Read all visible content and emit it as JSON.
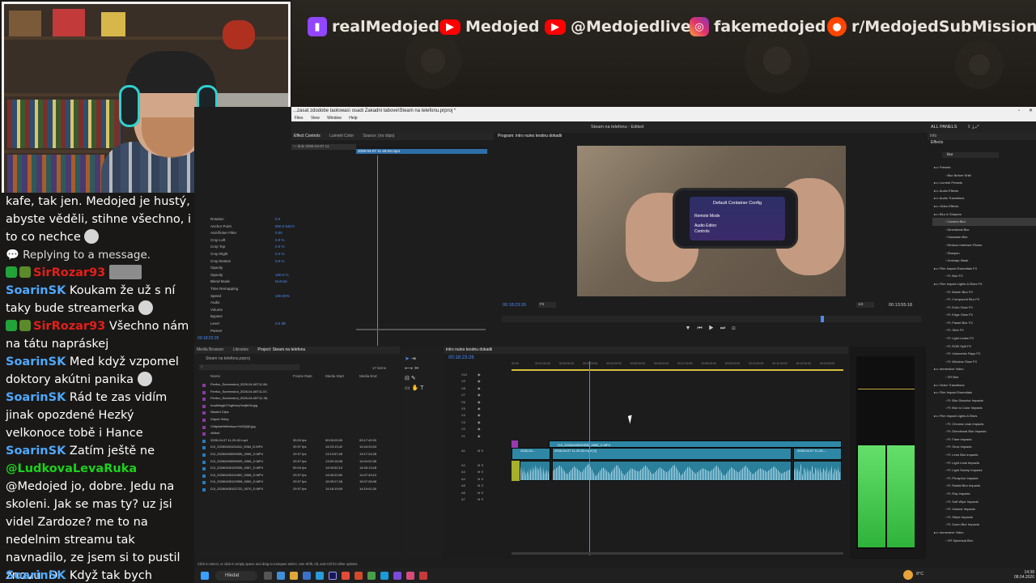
{
  "banner": {
    "socials": [
      {
        "icon": "twitch-icon",
        "label": "realMedojed"
      },
      {
        "icon": "youtube-icon",
        "label": "Medojed"
      },
      {
        "icon": "youtube-icon",
        "label": "@Medojedlive"
      },
      {
        "icon": "instagram-icon",
        "label": "fakemedojed"
      },
      {
        "icon": "reddit-icon",
        "label": "r/MedojedSubMissions"
      }
    ]
  },
  "chat": {
    "messages": [
      {
        "type": "text",
        "text": "kafe, tak jen. Medojed je hustý, abyste věděli, stihne všechno, i to co nechce"
      },
      {
        "type": "reply_notice",
        "text": "Replying to a message."
      },
      {
        "type": "msg",
        "user": "SirRozar93",
        "user_color": "#e0201b",
        "text": ""
      },
      {
        "type": "msg",
        "user": "SoarinSK",
        "user_color": "#4ea8ff",
        "text": "Koukam že už s ní taky bude streamerka"
      },
      {
        "type": "msg",
        "user": "SirRozar93",
        "user_color": "#e0201b",
        "text": "Všechno nám na tátu napráskej"
      },
      {
        "type": "msg",
        "user": "SoarinSK",
        "user_color": "#4ea8ff",
        "text": "Med když vzpomel doktory akútni panika"
      },
      {
        "type": "msg",
        "user": "SoarinSK",
        "user_color": "#4ea8ff",
        "text": "Rád te zas vidím jinak opozdené Hezký velkonoce tobě i Hance"
      },
      {
        "type": "msg",
        "user": "SoarinSK",
        "user_color": "#4ea8ff",
        "text": "Zatím ještě ne"
      },
      {
        "type": "mention",
        "mention": "@LudkovaLevaRuka",
        "text": "@Medojed jo, dobre. Jedu na skoleni. Jak se mas ty? uz jsi videl Zardoze? me to na nedelnim streamu tak navnadilo, ze jsem si to pustil znovu :D"
      },
      {
        "type": "msg",
        "user": "SoarinSK",
        "user_color": "#4ea8ff",
        "text": "Když tak bych napsal"
      }
    ]
  },
  "premiere": {
    "title_bar": "...zasat zdodobe taolowas\\ osadi Zakadni tabove\\Steam na telefonu.prproj *",
    "menu": [
      "Files",
      "View",
      "Window",
      "Help"
    ],
    "workspace_title": "Steam na telefonu - Edited",
    "workspace_right": "ALL PANELS",
    "effect_controls": {
      "tabs": [
        "Effect Controls",
        "Lumetri Color",
        "Source: (no clips)"
      ],
      "clip": "2026-04-07 11-25-52.mp4",
      "time": "00:18:23:26",
      "rows": [
        {
          "label": "Rotation",
          "value": "0.0"
        },
        {
          "label": "Anchor Point",
          "value": "960.0  540.0"
        },
        {
          "label": "Anti-flicker Filter",
          "value": "0.00"
        },
        {
          "label": "Crop Left",
          "value": "0.0 %"
        },
        {
          "label": "Crop Top",
          "value": "0.0 %"
        },
        {
          "label": "Crop Right",
          "value": "0.0 %"
        },
        {
          "label": "Crop Bottom",
          "value": "0.0 %"
        },
        {
          "label": "Opacity",
          "value": ""
        },
        {
          "label": "Opacity",
          "value": "100.0 %"
        },
        {
          "label": "Blend Mode",
          "value": "Normal"
        },
        {
          "label": "Time Remapping",
          "value": ""
        },
        {
          "label": "Speed",
          "value": "100.00%"
        },
        {
          "label": "Audio",
          "value": ""
        },
        {
          "label": "Volume",
          "value": ""
        },
        {
          "label": "Bypass",
          "value": ""
        },
        {
          "label": "Level",
          "value": "0.0 dB"
        },
        {
          "label": "Panner",
          "value": ""
        }
      ]
    },
    "program": {
      "tab": "Program: intro nuino teodnu dokadii",
      "timecode": "00:18:23:26",
      "fit": "Fit",
      "quality": "1/4",
      "duration": "00:13:55:18",
      "screen_title": "Default Container Config",
      "screen_l1": "Remote Mode",
      "screen_l2": "Audio Editor",
      "screen_l3": "Controls"
    },
    "project": {
      "tabs": [
        "Media Browser",
        "Libraries",
        "Project: Steam na telefonu"
      ],
      "path": "Steam na telefonu.prproj",
      "items_count": "17 items",
      "columns": [
        "Name",
        "Frame Rate",
        "Media Start",
        "Media End"
      ],
      "rows": [
        {
          "name": "Firefox_Screenshot_2026-04-06T11-56-",
          "fr": "",
          "start": "",
          "end": ""
        },
        {
          "name": "Firefox_Screenshot_2026-04-06T11-57-",
          "fr": "",
          "start": "",
          "end": ""
        },
        {
          "name": "Firefox_Screenshot_2026-04-06T12-36-",
          "fr": "",
          "start": "",
          "end": ""
        },
        {
          "name": "howtfdsgh27egfewq7smjfe9d.jpg",
          "fr": "",
          "start": "",
          "end": ""
        },
        {
          "name": "Nested Clips",
          "fr": "",
          "start": "",
          "end": ""
        },
        {
          "name": "Vtípné Videy",
          "fr": "",
          "start": "",
          "end": ""
        },
        {
          "name": "X3dpfwtrfrf8mhsunYd0Q0j9.jpg",
          "fr": "",
          "start": "",
          "end": ""
        },
        {
          "name": "ziNbof",
          "fr": "",
          "start": "",
          "end": ""
        },
        {
          "name": "2026-04-07 11-25-52.mp4",
          "fr": "30.00 fps",
          "start": "00:00:00:00",
          "end": "00:17:40:20"
        },
        {
          "name": "DJI_20260404104411_0064_D.MP4",
          "fr": "29.97 fps",
          "start": "14:23:13;42",
          "end": "14:44:24;04"
        },
        {
          "name": "DJI_20260405090535_0065_D.MP4",
          "fr": "29.97 fps",
          "start": "13:13:57;28",
          "end": "13:17:24;28"
        },
        {
          "name": "DJI_20260405095925_0066_D.MP4",
          "fr": "29.97 fps",
          "start": "13:59:16;08",
          "end": "14:04:02;35"
        },
        {
          "name": "DJI_20260405100935_0067_D.MP4",
          "fr": "59.94 fps",
          "start": "14:03:52;10",
          "end": "14:05:13;28"
        },
        {
          "name": "DJI_20260405101802_0068_D.MP4",
          "fr": "29.97 fps",
          "start": "14:06:20;50",
          "end": "14:07:49;10"
        },
        {
          "name": "DJI_20260405102508_0069_D.MP4",
          "fr": "29.97 fps",
          "start": "15:05:27;28",
          "end": "15:07:28;08"
        },
        {
          "name": "DJI_20260405102722_0070_D.MP4",
          "fr": "29.97 fps",
          "start": "14:18:19;09",
          "end": "14:19:01;30"
        }
      ]
    },
    "timeline": {
      "tab": "intro nuino teodnu dokadii",
      "timecode": "00:18:23:26",
      "ruler": [
        "00:00",
        "00:01:00:00",
        "00:02:00:00",
        "00:03:00:00",
        "00:04:00:00",
        "00:05:00:00",
        "00:06:00:00",
        "00:07:00:00",
        "00:08:00:00",
        "00:09:00:00",
        "00:10:00:00",
        "00:11:00:00",
        "00:12:00:00",
        "00:13:00:00"
      ],
      "video_tracks": [
        "V10",
        "V9",
        "V8",
        "V7",
        "V6",
        "V5",
        "V4",
        "V3",
        "V2",
        "V1"
      ],
      "audio_tracks": [
        "A1",
        "A2",
        "A3",
        "A4",
        "A5",
        "A6",
        "A7"
      ],
      "clip_v2": "DJI_20260405090535_0065_D.MP4",
      "clip_v1a": "2026-04-...",
      "clip_v1b": "2026-04-07 11-25-52.mp4 [V]",
      "clip_v1c": "2026-04-07 11-25-...",
      "audio_label": "Audio 1",
      "audio_label2": "Audio 2"
    },
    "effects": {
      "tabs": [
        "Info",
        "Effects"
      ],
      "search": "blur",
      "tree": [
        "Presets",
        "Blur Before Shift",
        "Lumetri Presets",
        "Audio Effects",
        "Audio Transitions",
        "Video Effects",
        "Blur & Sharpen",
        "Camera Blur",
        "Directional Blur",
        "Gaussian Blur",
        "Reduce Interlace Flicker",
        "Sharpen",
        "Unsharp Mask",
        "Film Impact Essentials FX",
        "FI: Blur FX",
        "Film Impact Lights & Blurs FX",
        "FI: Bokeh Blur FX",
        "FI: Compound Blur FX",
        "FI: Echo Glow FX",
        "FI: Edge Glow FX",
        "FI: Pastel Blur FX",
        "FI: Glint FX",
        "FI: Light Leaks FX",
        "FI: RGB Split FX",
        "FI: Volumetric Rays FX",
        "FI: Window Glow FX",
        "Immersive Video",
        "VR Blur",
        "Video Transitions",
        "Film Impact Essentials",
        "FI: Blur Dissolve Impacts",
        "FI: Blur to Color Impacts",
        "Film Impact Lights & Blurs",
        "FI: Chroma Leak Impacts",
        "FI: Directional Blur Impacts",
        "FI: Flare Impacts",
        "FI: Glow Impacts",
        "FI: Lens Blur Impacts",
        "FI: Light Leak Impacts",
        "FI: Light Sweep Impacts",
        "FI: Phosphor Impacts",
        "FI: Radial Blur Impacts",
        "FI: Ray Impacts",
        "FI: Soft Wipe Impacts",
        "FI: Volume Impacts",
        "FI: Stripe Impacts",
        "FI: Zoom Blur Impacts",
        "Immersive Video",
        "VR Spherical Blur"
      ]
    },
    "status_bar": "Click to select, or click in empty space and drag to marquee select. Use Shift, Alt, and Ctrl for other options."
  },
  "taskbar": {
    "search": "Hledat",
    "weather": "8°C",
    "time": "14:38",
    "date": "08.04.2026"
  }
}
